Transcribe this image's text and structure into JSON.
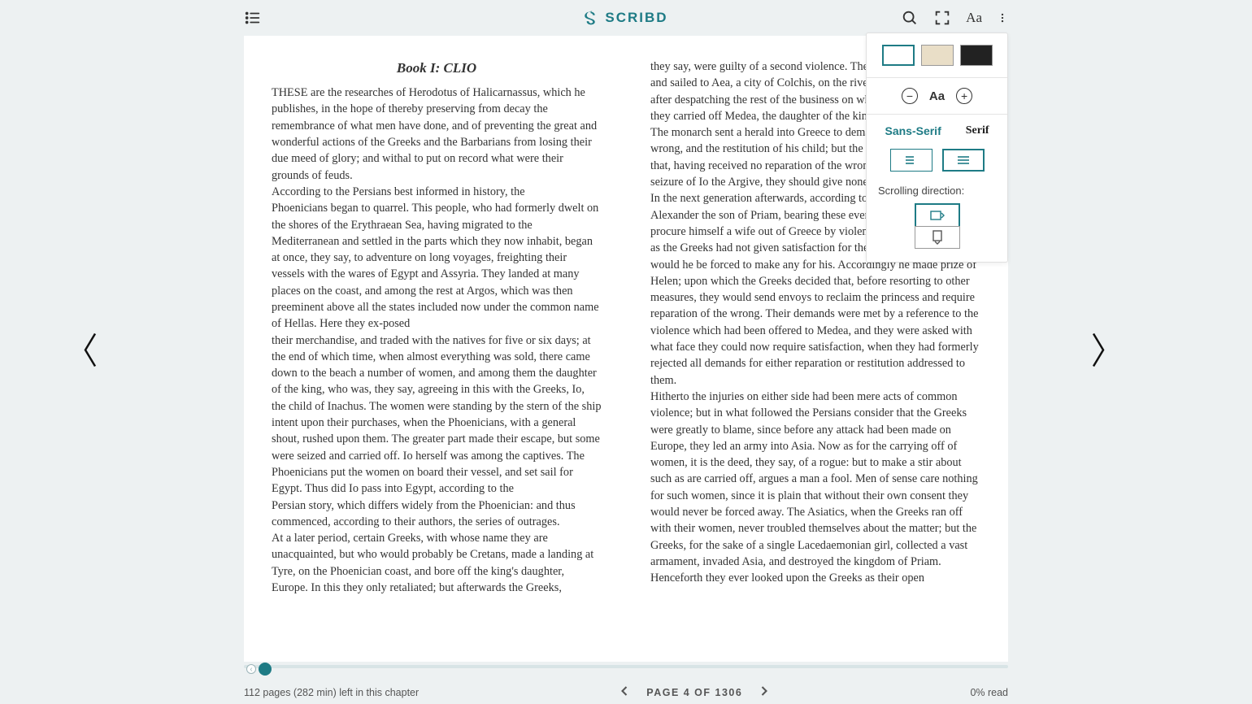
{
  "brand": "SCRIBD",
  "book_title": "Book I: CLIO",
  "columns": {
    "left": "THESE are the researches of Herodotus of Halicarnassus, which he publishes, in the hope of thereby preserving from decay the remembrance of what men have done, and of preventing the great and wonderful actions of the Greeks and the Barbarians from losing their due meed of glory; and withal to put on record what were their grounds of feuds.\nAccording to the Persians best informed in history, the\nPhoenicians began to quarrel. This people, who had formerly dwelt on the shores of the Erythraean Sea, having migrated to the Mediterranean and settled in the parts which they now inhabit, began at once, they say, to adventure on long voyages, freighting their vessels with the wares of Egypt and Assyria. They landed at many places on the coast, and among the rest at Argos, which was then preeminent above all the states included now under the common name of Hellas. Here they ex-posed\ntheir merchandise, and traded with the natives for five or six days; at the end of which time, when almost everything was sold, there came down to the beach a number of women, and among them the daughter of the king, who was, they say, agreeing in this with the Greeks, Io, the child of Inachus. The women were standing by the stern of the ship intent upon their purchases, when the Phoenicians, with a general shout, rushed upon them. The greater part made their escape, but some were seized and carried off. Io herself was among the captives. The Phoenicians put the women on board their vessel, and set sail for Egypt. Thus did Io pass into Egypt, according to the\nPersian story, which differs widely from the Phoenician: and thus commenced, according to their authors, the series of outrages.\nAt a later period, certain Greeks, with whose name they are unacquainted, but who would probably be Cretans, made a landing at Tyre, on the Phoenician coast, and bore off the king's daughter,\nEurope. In this they only retaliated; but afterwards the Greeks,",
    "right": "they say, were guilty of a second violence. They manned a ship of war, and sailed to Aea, a city of Colchis, on the river Phasis; from whence, after despatching the rest of the business on which they had come, they carried off Medea, the daughter of the king of the land.\nThe monarch sent a herald into Greece to demand reparation of the wrong, and the restitution of his child; but the Greeks made answer that, having received no reparation of the wrong done them in the seizure of Io the Argive, they should give none in this instance.\nIn the next generation afterwards, according to the same authorities, Alexander the son of Priam, bearing these events in mind, resolved to procure himself a wife out of Greece by violence, fully persuaded, that as the Greeks had not given satisfaction for their outrages, so neither would he be forced to make any for his. Accordingly he made prize of Helen; upon which the Greeks decided that, before resorting to other measures, they would send envoys to reclaim the princess and require reparation of the wrong. Their demands were met by a reference to the violence which had been offered to Medea, and they were asked with what face they could now require satisfaction, when they had formerly rejected all demands for either reparation or restitution addressed to them.\nHitherto the injuries on either side had been mere acts of common violence; but in what followed the Persians consider that the Greeks were greatly to blame, since before any attack had been made on Europe, they led an army into Asia. Now as for the carrying off of women, it is the deed, they say, of a rogue: but to make a stir about such as are carried off, argues a man a fool. Men of sense care nothing for such women, since it is plain that without their own consent they would never be forced away. The Asiatics, when the Greeks ran off with their women, never troubled themselves about the matter; but the Greeks, for the sake of a single Lacedaemonian girl, collected a vast armament, invaded Asia, and destroyed the kingdom of Priam. Henceforth they ever looked upon the Greeks as their open"
  },
  "footer": {
    "pages_left": "112 pages (282 min) left in this chapter",
    "page_label": "PAGE 4 OF 1306",
    "percent_read": "0% read"
  },
  "popup": {
    "sans_label": "Sans-Serif",
    "serif_label": "Serif",
    "aa": "Aa",
    "scroll_label": "Scrolling direction:"
  }
}
